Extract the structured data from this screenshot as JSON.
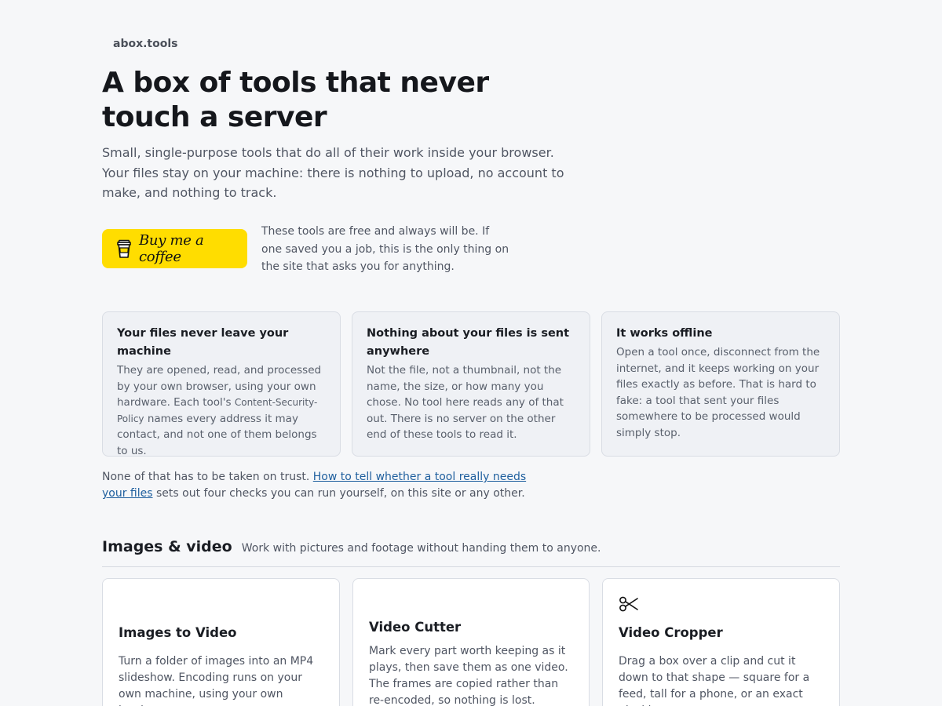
{
  "brand": "abox.tools",
  "hero": {
    "title": "A box of tools that never touch a server",
    "subtitle": "Small, single-purpose tools that do all of their work inside your browser. Your files stay on your machine: there is nothing to upload, no account to make, and nothing to track."
  },
  "support": {
    "button_label": "Buy me a coffee",
    "note": "These tools are free and always will be. If one saved you a job, this is the only thing on the site that asks you for anything."
  },
  "features": [
    {
      "title": "Your files never leave your machine",
      "body_before": "They are opened, read, and processed by your own browser, using your own hardware. Each tool's ",
      "code": "Content-Security-Policy",
      "body_after": " names every address it may contact, and not one of them belongs to us."
    },
    {
      "title": "Nothing about your files is sent anywhere",
      "body": "Not the file, not a thumbnail, not the name, the size, or how many you chose. No tool here reads any of that out. There is no server on the other end of these tools to read it."
    },
    {
      "title": "It works offline",
      "body": "Open a tool once, disconnect from the internet, and it keeps working on your files exactly as before. That is hard to fake: a tool that sent your files somewhere to be processed would simply stop."
    }
  ],
  "trust": {
    "before": "None of that has to be taken on trust. ",
    "link": "How to tell whether a tool really needs your files",
    "after": " sets out four checks you can run yourself, on this site or any other."
  },
  "section": {
    "title": "Images & video",
    "subtitle": "Work with pictures and footage without handing them to anyone."
  },
  "tools": [
    {
      "name": "Images to Video",
      "description": "Turn a folder of images into an MP4 slideshow. Encoding runs on your own machine, using your own hardware."
    },
    {
      "name": "Video Cutter",
      "description": "Mark every part worth keeping as it plays, then save them as one video. The frames are copied rather than re-encoded, so nothing is lost."
    },
    {
      "name": "Video Cropper",
      "icon": "scissors-icon",
      "description": "Drag a box over a clip and cut it down to that shape — square for a feed, tall for a phone, or an exact pixel box."
    }
  ]
}
